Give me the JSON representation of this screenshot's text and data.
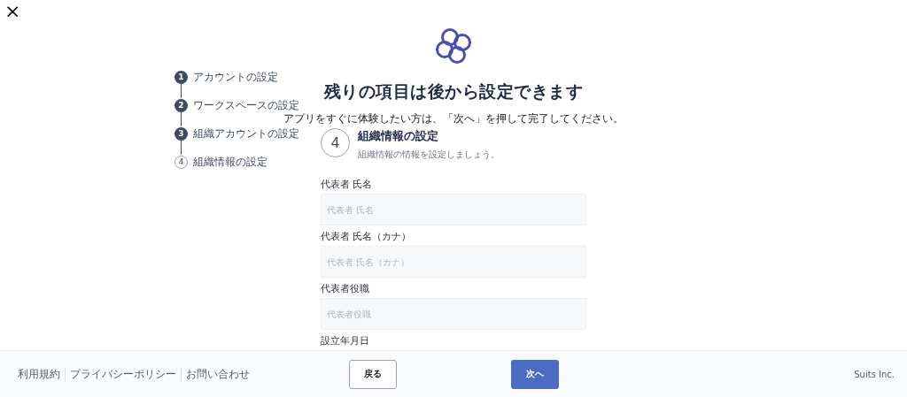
{
  "close": {
    "label": "×"
  },
  "steps": [
    {
      "number": "1",
      "label": "アカウントの設定",
      "completed": true
    },
    {
      "number": "2",
      "label": "ワークスペースの設定",
      "completed": true
    },
    {
      "number": "3",
      "label": "組織アカウントの設定",
      "completed": true
    },
    {
      "number": "4",
      "label": "組織情報の設定",
      "completed": false
    }
  ],
  "title": "残りの項目は後から設定できます",
  "subtitle": "アプリをすぐに体験したい方は、「次へ」を押して完了してください。",
  "section": {
    "number": "4",
    "heading": "組織情報の設定",
    "description": "組織情報の情報を設定しましょう。"
  },
  "fields": [
    {
      "label": "代表者 氏名",
      "placeholder": "代表者 氏名"
    },
    {
      "label": "代表者 氏名（カナ）",
      "placeholder": "代表者 氏名（カナ）"
    },
    {
      "label": "代表者役職",
      "placeholder": "代表者役職"
    },
    {
      "label": "設立年月日"
    }
  ],
  "footer": {
    "links": [
      "利用規約",
      "プライバシーポリシー",
      "お問い合わせ"
    ],
    "back_button": "戻る",
    "next_button": "次へ",
    "company": "Suits Inc."
  }
}
